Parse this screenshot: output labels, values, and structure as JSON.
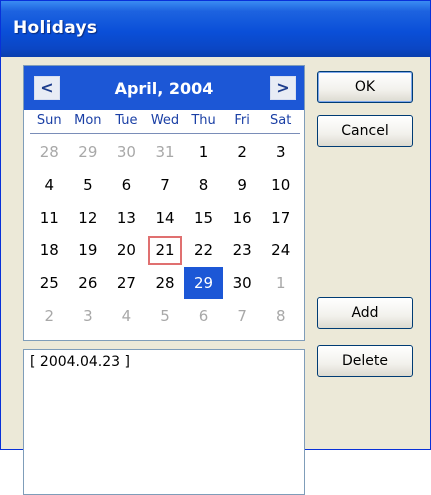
{
  "window": {
    "title": "Holidays"
  },
  "calendar": {
    "month_label": "April, 2004",
    "prev_label": "<",
    "next_label": ">",
    "weekdays": [
      "Sun",
      "Mon",
      "Tue",
      "Wed",
      "Thu",
      "Fri",
      "Sat"
    ],
    "weeks": [
      [
        "28",
        "29",
        "30",
        "31",
        "1",
        "2",
        "3"
      ],
      [
        "4",
        "5",
        "6",
        "7",
        "8",
        "9",
        "10"
      ],
      [
        "11",
        "12",
        "13",
        "14",
        "15",
        "16",
        "17"
      ],
      [
        "18",
        "19",
        "20",
        "21",
        "22",
        "23",
        "24"
      ],
      [
        "25",
        "26",
        "27",
        "28",
        "29",
        "30",
        "1"
      ],
      [
        "2",
        "3",
        "4",
        "5",
        "6",
        "7",
        "8"
      ]
    ],
    "today": "21",
    "selected": "29",
    "accent_color": "#1c57d6"
  },
  "buttons": {
    "ok": "OK",
    "cancel": "Cancel",
    "add": "Add",
    "delete": "Delete"
  },
  "holidays": [
    "[ 2004.04.23 ]"
  ]
}
